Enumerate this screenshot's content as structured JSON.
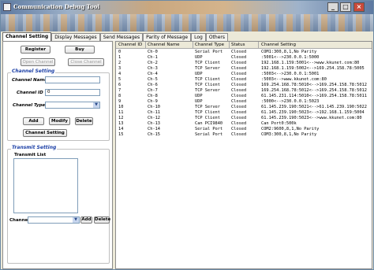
{
  "window": {
    "title": "Communication Debug Tool"
  },
  "tabs": [
    {
      "label": "Channel Setting"
    },
    {
      "label": "Display Messages"
    },
    {
      "label": "Send Messages"
    },
    {
      "label": "Parity of Message"
    },
    {
      "label": "Log"
    },
    {
      "label": "Others"
    }
  ],
  "left": {
    "register_label": "Register",
    "buy_label": "Buy",
    "open_channel_label": "Open Channel",
    "close_channel_label": "Close Channel",
    "channel_setting": {
      "group_label": "Channel Setting",
      "name_label": "Channel Name",
      "name_value": "",
      "id_label": "Channel ID",
      "id_value": "0",
      "type_label": "Channel Type",
      "type_value": "",
      "add_label": "Add",
      "modify_label": "Modify",
      "delete_label": "Delete",
      "setting_label": "Channel Setting"
    },
    "transmit": {
      "group_label": "Transmit Setting",
      "list_label": "Transmit List",
      "channel_label": "Channel",
      "channel_value": "",
      "add_label": "Add",
      "delete_label": "Delete"
    }
  },
  "table": {
    "columns": [
      "Channel ID",
      "Channel Name",
      "Channel Type",
      "Status",
      "Channel Setting"
    ],
    "rows": [
      [
        "0",
        "Ch-0",
        "Serial Port",
        "Closed",
        "COM1:300,8,1,No Parity"
      ],
      [
        "1",
        "Ch-1",
        "UDP",
        "Closed",
        ":5001<-->230.0.0.1:5000"
      ],
      [
        "2",
        "Ch-2",
        "TCP Client",
        "Closed",
        "192.168.1.159:5001<-->www.kkunet.com:80"
      ],
      [
        "3",
        "Ch-3",
        "TCP Server",
        "Closed",
        "192.168.1.159:5002<-->169.254.158.78:5005"
      ],
      [
        "4",
        "Ch-4",
        "UDP",
        "Closed",
        ":5003<-->230.0.0.1:5001"
      ],
      [
        "5",
        "Ch-5",
        "TCP Client",
        "Closed",
        ":5003<-->www.kkunet.com:80"
      ],
      [
        "6",
        "Ch-6",
        "TCP Client",
        "Closed",
        "169.254.168.78:5010<-->169.254.158.78:5012"
      ],
      [
        "7",
        "Ch-7",
        "TCP Server",
        "Closed",
        "169.254.168.78:5012<-->169.254.158.78:5012"
      ],
      [
        "8",
        "Ch-8",
        "UDP",
        "Closed",
        "61.145.231.114:5010<-->169.254.158.78:5011"
      ],
      [
        "9",
        "Ch-9",
        "UDP",
        "Closed",
        ":5000<-->230.0.0.1:5023"
      ],
      [
        "10",
        "Ch-10",
        "TCP Server",
        "Closed",
        "61.145.239.190:5021<-->61.145.239.190:5022"
      ],
      [
        "11",
        "Ch-11",
        "TCP Client",
        "Closed",
        "61.145.239.190:5023<-->192.168.1.159:5004"
      ],
      [
        "12",
        "Ch-12",
        "TCP Client",
        "Closed",
        "61.145.239.190:5023<-->www.kkunet.com:80"
      ],
      [
        "13",
        "Ch-13",
        "Can PCI9840",
        "Closed",
        "Can Port0:500k"
      ],
      [
        "14",
        "Ch-14",
        "Serial Port",
        "Closed",
        "COM2:9600,8,1,No Parity"
      ],
      [
        "15",
        "Ch-15",
        "Serial Port",
        "Closed",
        "COM3:300,8,1,No Parity"
      ]
    ]
  }
}
